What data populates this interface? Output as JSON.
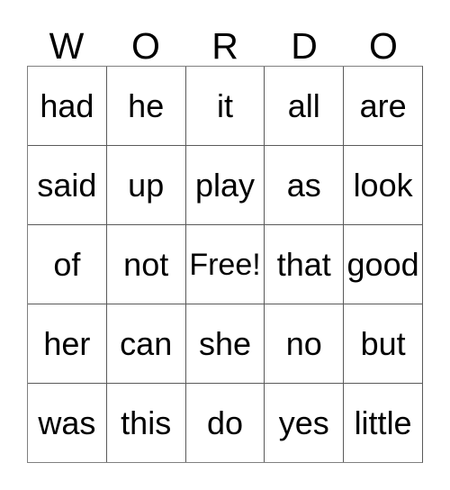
{
  "card": {
    "title_letters": [
      "W",
      "O",
      "R",
      "D",
      "O"
    ],
    "rows": [
      {
        "cells": [
          "had",
          "he",
          "it",
          "all",
          "are"
        ]
      },
      {
        "cells": [
          "said",
          "up",
          "play",
          "as",
          "look"
        ]
      },
      {
        "cells": [
          "of",
          "not",
          "Free!",
          "that",
          "good"
        ]
      },
      {
        "cells": [
          "her",
          "can",
          "she",
          "no",
          "but"
        ]
      },
      {
        "cells": [
          "was",
          "this",
          "do",
          "yes",
          "little"
        ]
      }
    ],
    "colors": {
      "background": "#ffffff",
      "grid_line": "#5a5a5a",
      "text": "#000000"
    }
  }
}
